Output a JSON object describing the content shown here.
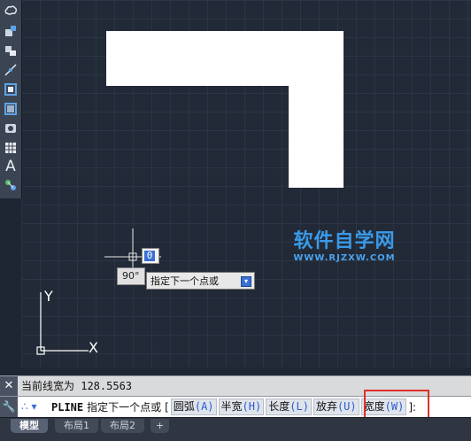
{
  "toolbar": {
    "tools": [
      {
        "name": "cloud-revision-icon"
      },
      {
        "name": "insert-block-icon"
      },
      {
        "name": "make-block-icon"
      },
      {
        "name": "point-icon"
      },
      {
        "name": "hatch-icon"
      },
      {
        "name": "gradient-icon"
      },
      {
        "name": "region-icon"
      },
      {
        "name": "table-icon"
      },
      {
        "name": "multiline-text-icon",
        "glyph": "A"
      },
      {
        "name": "add-selected-icon"
      }
    ]
  },
  "dynamic_input": {
    "value": "0",
    "angle": "90°",
    "prompt": "指定下一个点或"
  },
  "watermark": {
    "title": "软件自学网",
    "url": "WWW.RJZXW.COM"
  },
  "ucs": {
    "x_label": "X",
    "y_label": "Y"
  },
  "history": {
    "text": "当前线宽为 128.5563"
  },
  "command": {
    "name": "PLINE",
    "prompt": "指定下一个点或",
    "open_bracket": "[",
    "options": [
      {
        "label": "圆弧",
        "key": "(A)"
      },
      {
        "label": "半宽",
        "key": "(H)"
      },
      {
        "label": "长度",
        "key": "(L)"
      },
      {
        "label": "放弃",
        "key": "(U)"
      },
      {
        "label": "宽度",
        "key": "(W)"
      }
    ],
    "close": "]:"
  },
  "tabs": [
    {
      "label": "模型",
      "active": true
    },
    {
      "label": "布局1",
      "active": false
    },
    {
      "label": "布局2",
      "active": false
    }
  ],
  "add_tab_label": "+",
  "colors": {
    "canvas_bg": "#222a37",
    "highlight": "#e0302a",
    "option_key": "#2a5bd7",
    "watermark": "#3a9ae8"
  }
}
